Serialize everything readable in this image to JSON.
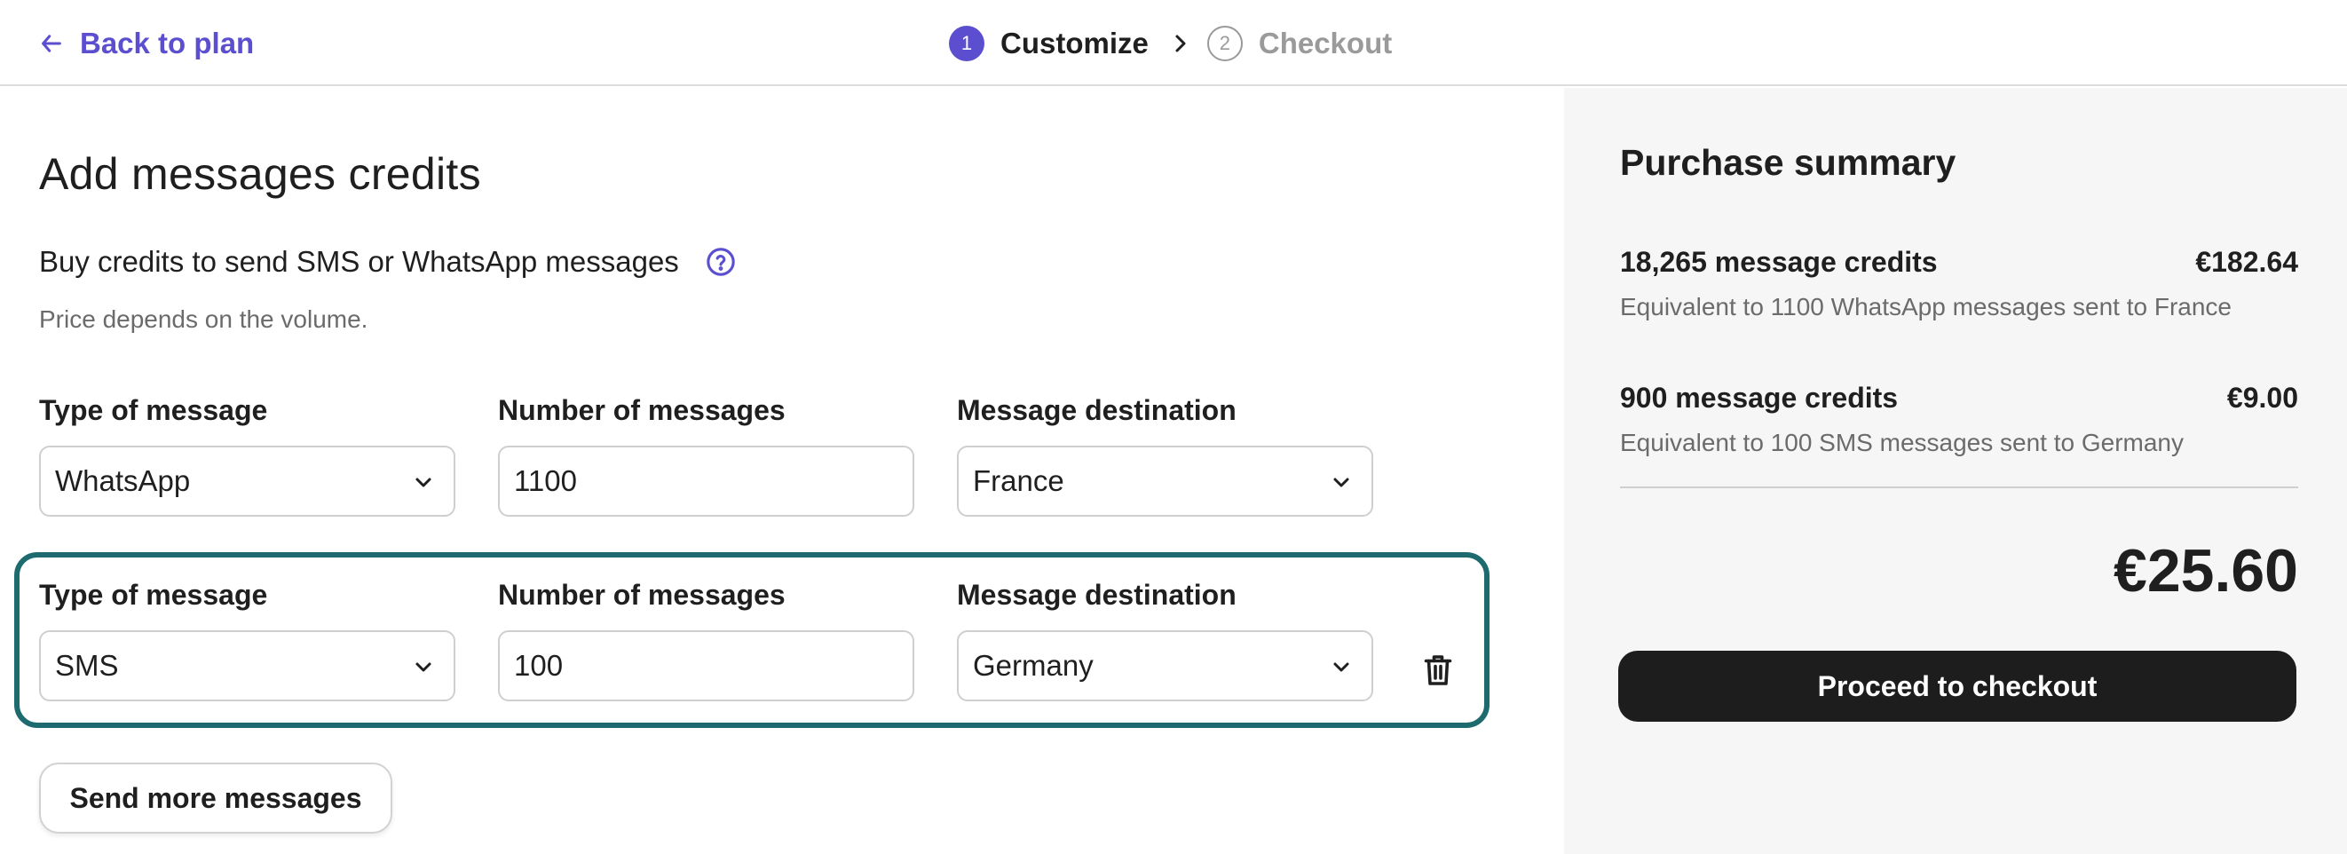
{
  "header": {
    "back_label": "Back to plan",
    "steps": [
      {
        "number": "1",
        "label": "Customize"
      },
      {
        "number": "2",
        "label": "Checkout"
      }
    ]
  },
  "main": {
    "title": "Add messages credits",
    "subtitle": "Buy credits to send SMS or WhatsApp messages",
    "hint": "Price depends on the volume.",
    "labels": {
      "type": "Type of message",
      "number": "Number of messages",
      "destination": "Message destination"
    },
    "rows": [
      {
        "type": "WhatsApp",
        "number": "1100",
        "destination": "France"
      },
      {
        "type": "SMS",
        "number": "100",
        "destination": "Germany"
      }
    ],
    "more_button": "Send more messages"
  },
  "summary": {
    "title": "Purchase summary",
    "items": [
      {
        "credits": "18,265 message credits",
        "price": "€182.64",
        "detail": "Equivalent to 1100 WhatsApp messages sent to France"
      },
      {
        "credits": "900 message credits",
        "price": "€9.00",
        "detail": "Equivalent to 100 SMS messages sent to Germany"
      }
    ],
    "total": "€25.60",
    "checkout_button": "Proceed to checkout"
  },
  "colors": {
    "accent": "#5b4fcf",
    "highlight_border": "#1d6b6e",
    "primary_button": "#1d1d1d"
  }
}
